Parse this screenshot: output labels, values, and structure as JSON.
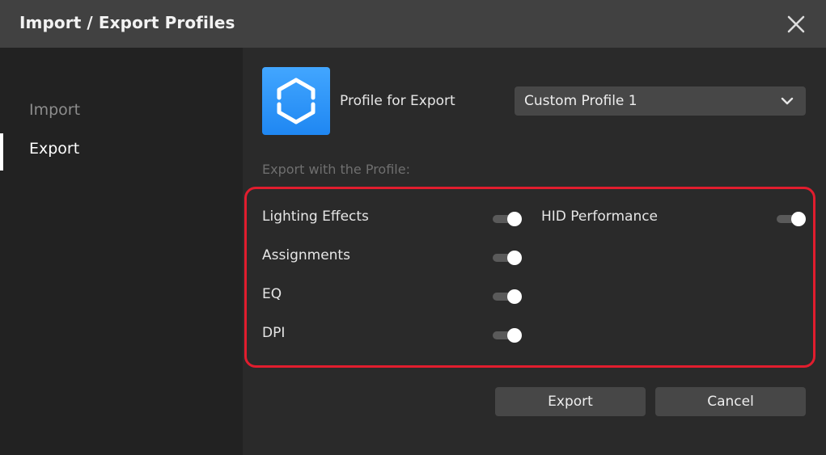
{
  "window": {
    "title": "Import / Export Profiles",
    "close_icon": "close-icon"
  },
  "sidebar": {
    "items": [
      {
        "label": "Import",
        "selected": false
      },
      {
        "label": "Export",
        "selected": true
      }
    ]
  },
  "profile": {
    "icon": "hexagon-profile-icon",
    "label": "Profile for Export",
    "selected_value": "Custom Profile 1",
    "dropdown_icon": "chevron-down-icon"
  },
  "export_options": {
    "section_label": "Export with the Profile:",
    "items": [
      {
        "label": "Lighting Effects",
        "enabled": true
      },
      {
        "label": "Assignments",
        "enabled": true
      },
      {
        "label": "EQ",
        "enabled": true
      },
      {
        "label": "DPI",
        "enabled": true
      },
      {
        "label": "HID Performance",
        "enabled": true
      }
    ]
  },
  "actions": {
    "export_label": "Export",
    "cancel_label": "Cancel"
  },
  "colors": {
    "titlebar": "#414141",
    "sidebar": "#222222",
    "content": "#2a2a2a",
    "accent_blue": "#2a93f8",
    "highlight_red": "#e11d2e",
    "button": "#474747"
  }
}
